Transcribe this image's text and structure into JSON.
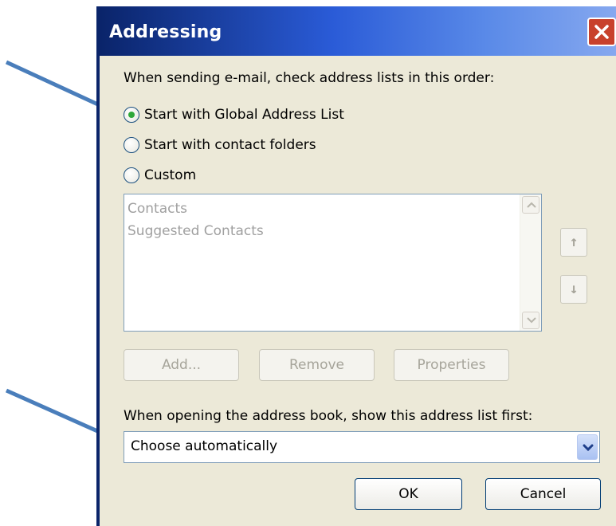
{
  "dialog": {
    "title": "Addressing",
    "close_icon": "close-icon"
  },
  "send": {
    "label": "When sending e-mail, check address lists in this order:",
    "options": [
      {
        "label": "Start with Global Address List",
        "checked": true
      },
      {
        "label": "Start with contact folders",
        "checked": false
      },
      {
        "label": "Custom",
        "checked": false
      }
    ]
  },
  "list": {
    "items": [
      "Contacts",
      "Suggested Contacts"
    ]
  },
  "move": {
    "up_glyph": "↑",
    "down_glyph": "↓"
  },
  "actions": {
    "add": "Add...",
    "remove": "Remove",
    "properties": "Properties"
  },
  "open": {
    "label": "When opening the address book, show this address list first:",
    "selected": "Choose automatically"
  },
  "footer": {
    "ok": "OK",
    "cancel": "Cancel"
  },
  "colors": {
    "titlebar": "#0a246a",
    "window_bg": "#ece9d8",
    "annotation_arrow": "#4a7ebb",
    "radio_checked": "#2fa83a"
  }
}
